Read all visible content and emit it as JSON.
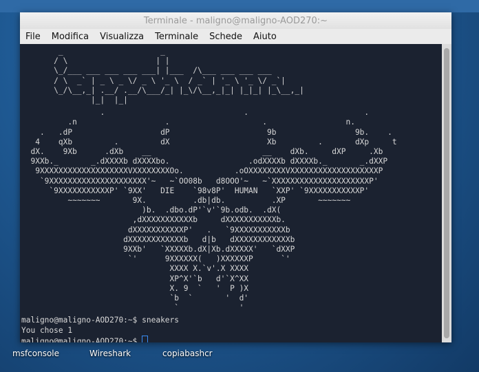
{
  "window": {
    "title": "Terminale - maligno@maligno-AOD270:~"
  },
  "menu": [
    "File",
    "Modifica",
    "Visualizza",
    "Terminale",
    "Schede",
    "Aiuto"
  ],
  "terminal": {
    "banner": "        _                     _                      \n       / \\                   | |                     \n       \\_/___ ___ ___ ___ ___| |___  /\\___ ___ ___ ___\n       / \\  _` | _ \\ _ \\/ _ \\ '_ \\  / _` | '_ \\ '_ \\/ _`|\n       \\_/\\__,_| .__/ .__/\\___/_| |_\\/\\__,_|_| |_|_| |_\\__,_|\n               |_|  |_|                                  \n",
    "art": [
      "                 .                              .                         .",
      "          .n                   .                    .                 n.",
      "    .   .dP                   dP                     9b                 9b.    .",
      "   4    qXb         .         dX                     Xb         .       dXp     t",
      "  dX.    9Xb      .dXb    __                        __    dXb.     dXP     .Xb",
      "  9XXb._       _.dXXXXb dXXXXbo.                 .odXXXXb dXXXXb._       _.dXXP",
      "   9XXXXXXXXXXXXXXXXXXXVXXXXXXXXOo.           .oOXXXXXXXXVXXXXXXXXXXXXXXXXXXXP",
      "    `9XXXXXXXXXXXXXXXXXXXXX'~   ~`OO08b   d8OOO'~   ~`XXXXXXXXXXXXXXXXXXXXXP'",
      "      `9XXXXXXXXXXXP' `9XX'   DIE    `98v8P'  HUMAN   `XXP' `9XXXXXXXXXXXP'",
      "          ~~~~~~~       9X.          .db|db.          .XP       ~~~~~~~",
      "                          )b.  .dbo.dP'`v'`9b.odb.  .dX(",
      "                        ,dXXXXXXXXXXXb     dXXXXXXXXXXXb.",
      "                       dXXXXXXXXXXXP'   .   `9XXXXXXXXXXXb",
      "                      dXXXXXXXXXXXXb   d|b   dXXXXXXXXXXXXb",
      "                      9XXb'   `XXXXXb.dX|Xb.dXXXXX'   `dXXP",
      "                       `'      9XXXXXX(   )XXXXXXP      `'",
      "                                XXXX X.`v'.X XXXX",
      "                                XP^X'`b   d'`X^XX",
      "                                X. 9  `   '  P )X",
      "                                `b  `       '  d'",
      "                                 `             '"
    ],
    "lines": [
      "maligno@maligno-AOD270:~$ sneakers",
      "You chose 1",
      "maligno@maligno-AOD270:~$ "
    ]
  },
  "desktop_icons": [
    "msfconsole",
    "Wireshark",
    "copiabashcr"
  ]
}
